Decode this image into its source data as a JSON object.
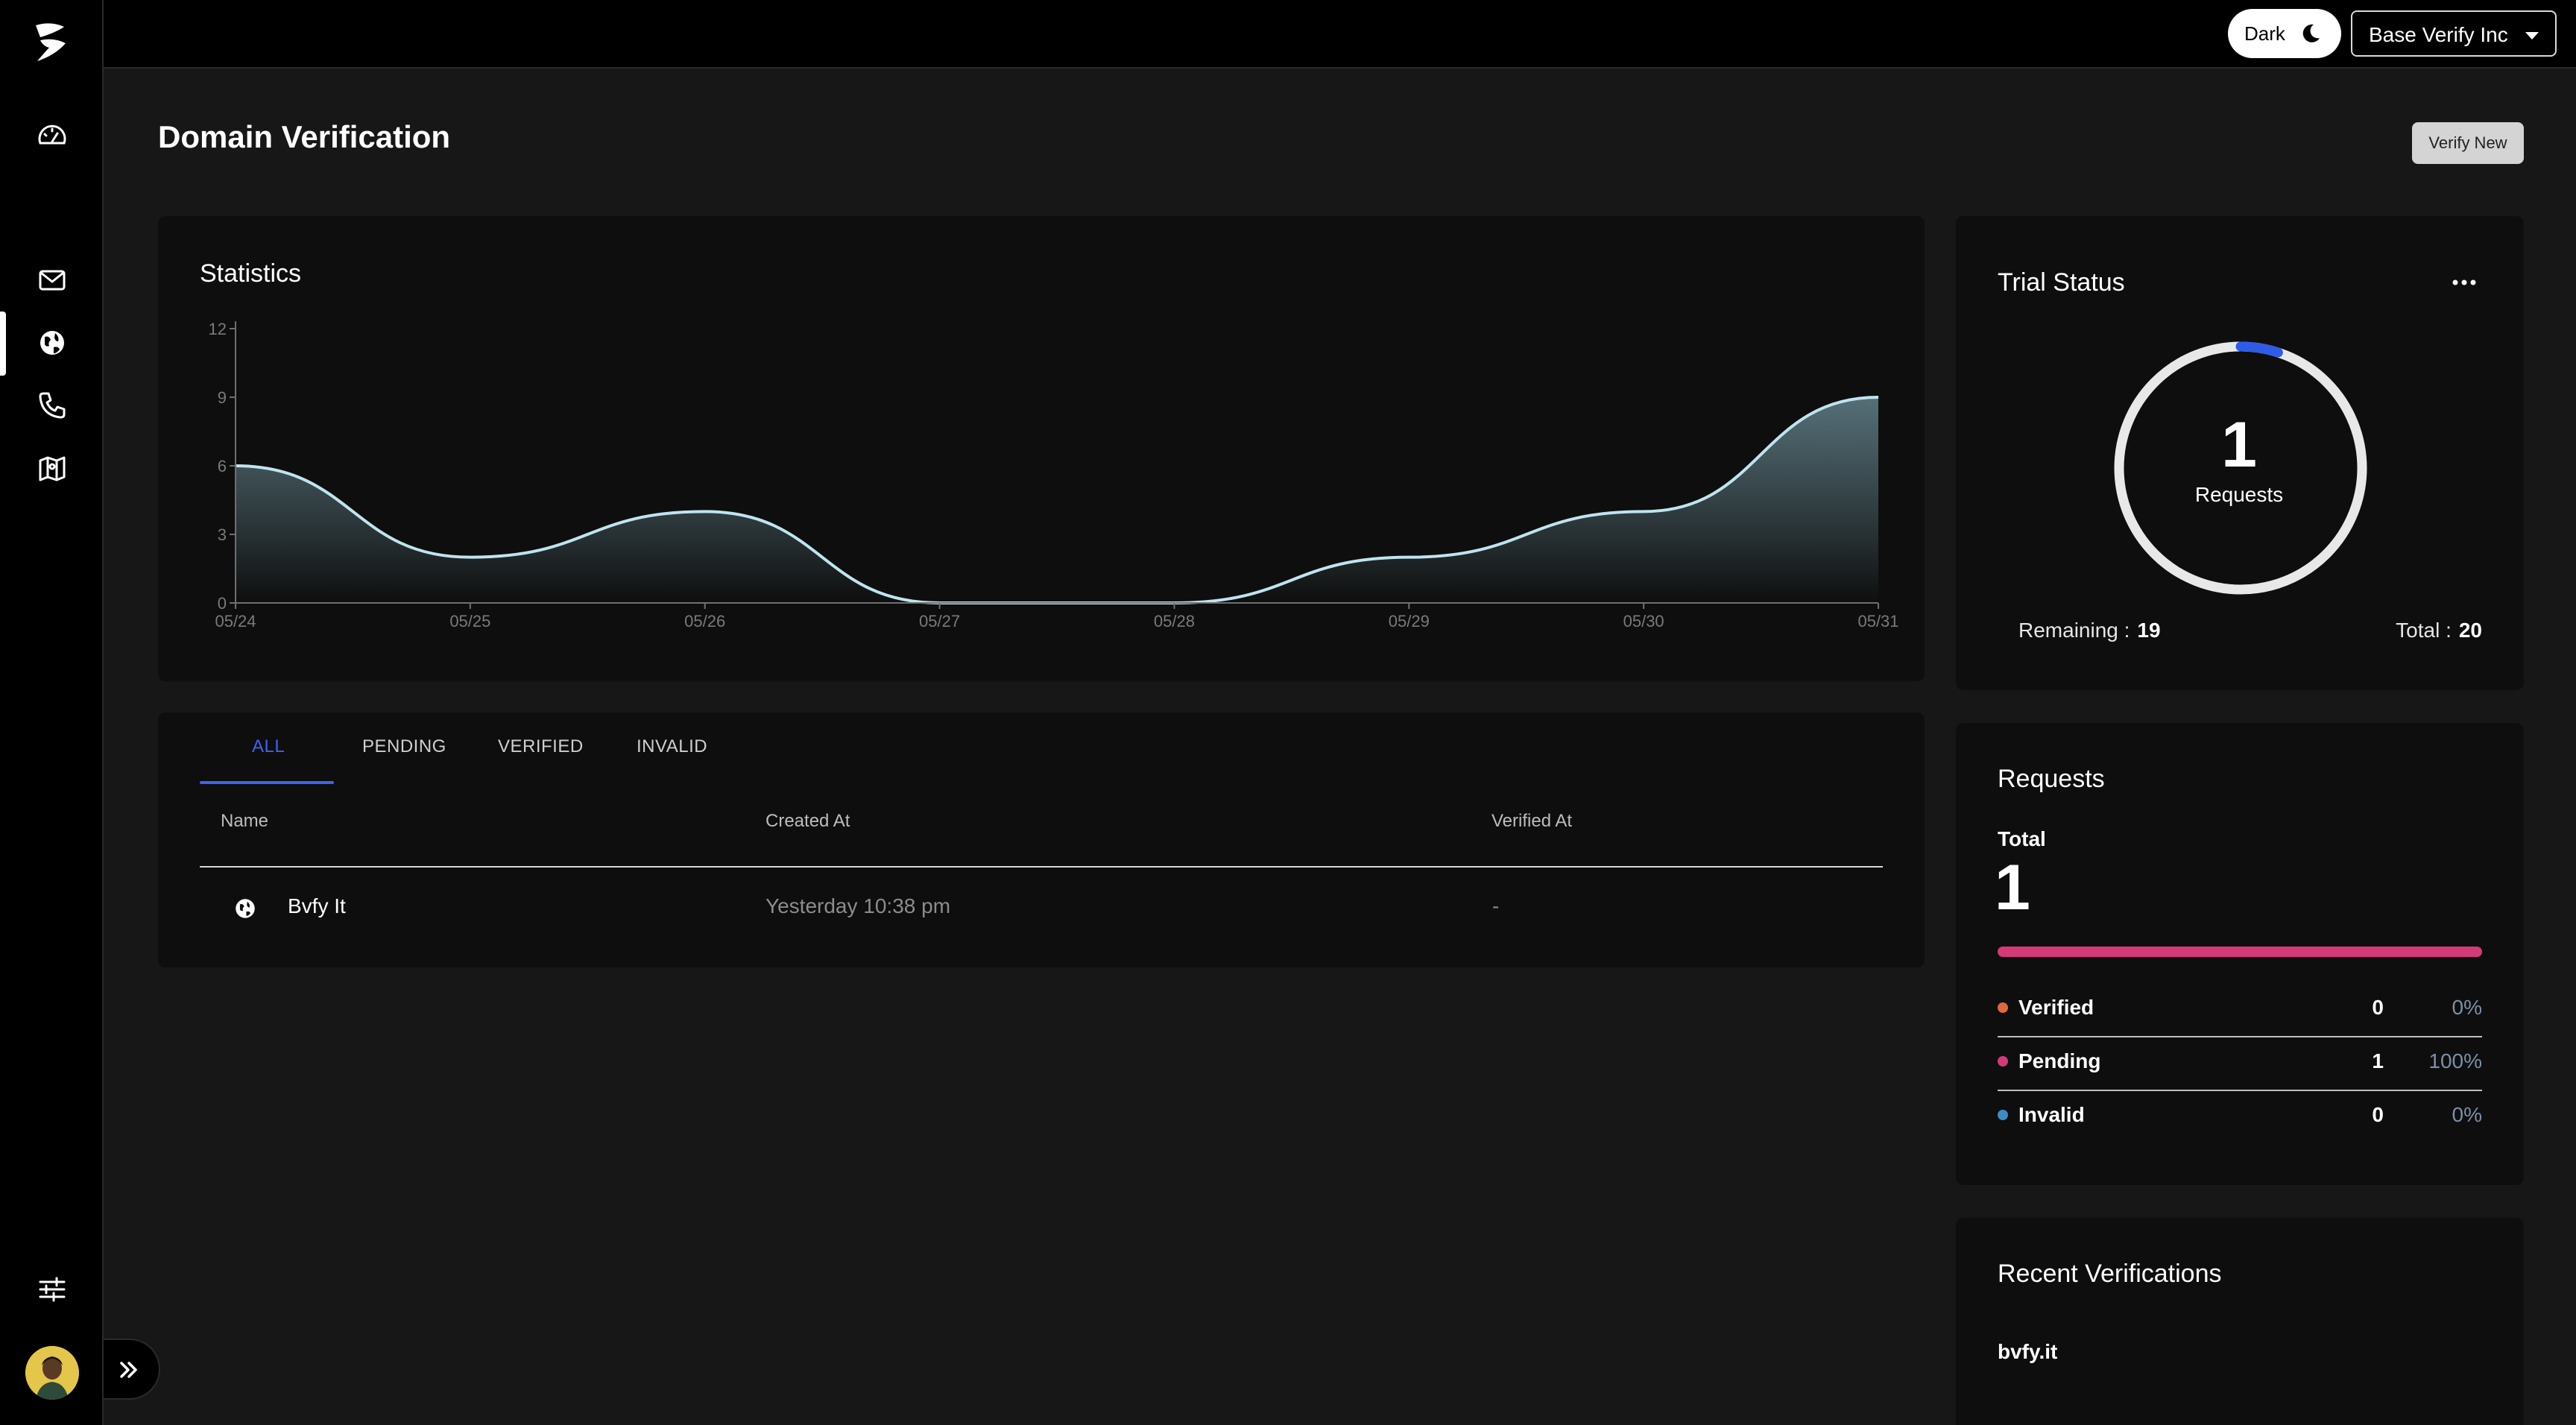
{
  "topbar": {
    "theme_label": "Dark",
    "org_name": "Base Verify Inc"
  },
  "header": {
    "title": "Domain Verification",
    "verify_new_label": "Verify New"
  },
  "statistics": {
    "title": "Statistics"
  },
  "chart_data": {
    "type": "area",
    "title": "",
    "xlabel": "",
    "ylabel": "",
    "x": [
      "05/24",
      "05/25",
      "05/26",
      "05/27",
      "05/28",
      "05/29",
      "05/30",
      "05/31"
    ],
    "values": [
      6,
      2,
      4,
      0,
      0,
      2,
      4,
      9
    ],
    "ylim": [
      0,
      12
    ],
    "yticks": [
      0,
      3,
      6,
      9,
      12
    ],
    "grid": false,
    "colors": {
      "line": "#bfe4ef",
      "fill_top": "#5d7a83",
      "fill_bottom": "#0e0e0e"
    }
  },
  "table": {
    "tabs": [
      "ALL",
      "PENDING",
      "VERIFIED",
      "INVALID"
    ],
    "active_tab": "ALL",
    "columns": [
      "Name",
      "Created At",
      "Verified At"
    ],
    "rows": [
      {
        "icon": "globe-icon",
        "name": "Bvfy It",
        "created_at": "Yesterday 10:38 pm",
        "verified_at": "-"
      }
    ]
  },
  "trial_status": {
    "title": "Trial Status",
    "used": 1,
    "used_label": "Requests",
    "remaining_label": "Remaining :",
    "remaining": "19",
    "total_label": "Total :",
    "total": "20",
    "ring_color": "#2f5ce6",
    "ring_track_color": "#e8e8e8"
  },
  "requests": {
    "title": "Requests",
    "total_label": "Total",
    "total": "1",
    "bar_color": "#d23a78",
    "rows": [
      {
        "name": "Verified",
        "count": "0",
        "percent": "0%",
        "color": "#e0683a"
      },
      {
        "name": "Pending",
        "count": "1",
        "percent": "100%",
        "color": "#d23a78"
      },
      {
        "name": "Invalid",
        "count": "0",
        "percent": "0%",
        "color": "#3d8bc4"
      }
    ]
  },
  "recent": {
    "title": "Recent Verifications",
    "items": [
      "bvfy.it"
    ]
  },
  "sidebar": {
    "icons": [
      "dashboard-icon",
      "mail-icon",
      "globe-icon",
      "phone-icon",
      "map-icon",
      "settings-sliders-icon"
    ],
    "active": "globe-icon"
  }
}
